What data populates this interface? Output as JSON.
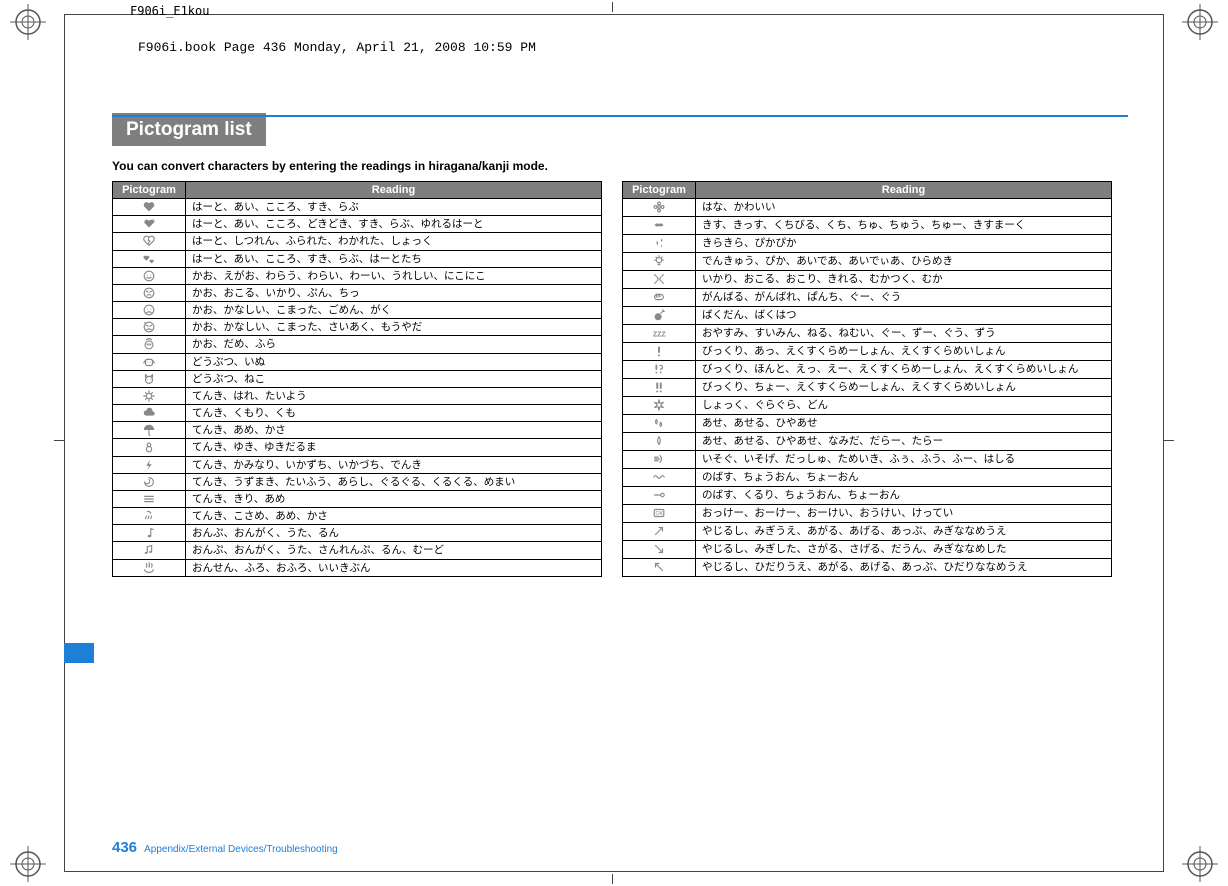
{
  "crop": {
    "filename": "F906i_E1kou",
    "header_note": "F906i.book  Page 436  Monday, April 21, 2008  10:59 PM"
  },
  "page": {
    "title": "Pictogram list",
    "intro": "You can convert characters by entering the readings in hiragana/kanji mode.",
    "footer_page": "436",
    "footer_section": "Appendix/External Devices/Troubleshooting"
  },
  "headers": {
    "picto": "Pictogram",
    "reading": "Reading"
  },
  "left": [
    {
      "p": "heart",
      "r": "はーと、あい、こころ、すき、らぶ"
    },
    {
      "p": "heart-beat",
      "r": "はーと、あい、こころ、どきどき、すき、らぶ、ゆれるはーと"
    },
    {
      "p": "heart-broken",
      "r": "はーと、しつれん、ふられた、わかれた、しょっく"
    },
    {
      "p": "hearts",
      "r": "はーと、あい、こころ、すき、らぶ、はーとたち"
    },
    {
      "p": "face-smile",
      "r": "かお、えがお、わらう、わらい、わーい、うれしい、にこにこ"
    },
    {
      "p": "face-angry",
      "r": "かお、おこる、いかり、ぷん、ちっ"
    },
    {
      "p": "face-sad",
      "r": "かお、かなしい、こまった、ごめん、がく"
    },
    {
      "p": "face-despair",
      "r": "かお、かなしい、こまった、さいあく、もうやだ"
    },
    {
      "p": "face-dizzy",
      "r": "かお、だめ、ふら"
    },
    {
      "p": "dog",
      "r": "どうぶつ、いぬ"
    },
    {
      "p": "cat",
      "r": "どうぶつ、ねこ"
    },
    {
      "p": "sun",
      "r": "てんき、はれ、たいよう"
    },
    {
      "p": "cloud",
      "r": "てんき、くもり、くも"
    },
    {
      "p": "umbrella",
      "r": "てんき、あめ、かさ"
    },
    {
      "p": "snowman",
      "r": "てんき、ゆき、ゆきだるま"
    },
    {
      "p": "lightning",
      "r": "てんき、かみなり、いかずち、いかづち、でんき"
    },
    {
      "p": "typhoon",
      "r": "てんき、うずまき、たいふう、あらし、ぐるぐる、くるくる、めまい"
    },
    {
      "p": "mist",
      "r": "てんき、きり、あめ"
    },
    {
      "p": "drizzle",
      "r": "てんき、こさめ、あめ、かさ"
    },
    {
      "p": "note",
      "r": "おんぷ、おんがく、うた、るん"
    },
    {
      "p": "notes",
      "r": "おんぷ、おんがく、うた、さんれんぷ、るん、むーど"
    },
    {
      "p": "hotspring",
      "r": "おんせん、ふろ、おふろ、いいきぶん"
    }
  ],
  "right": [
    {
      "p": "flower",
      "r": "はな、かわいい"
    },
    {
      "p": "kiss",
      "r": "きす、きっす、くちびる、くち、ちゅ、ちゅう、ちゅー、きすまーく"
    },
    {
      "p": "sparkle",
      "r": "きらきら、ぴかぴか"
    },
    {
      "p": "lightbulb",
      "r": "でんきゅう、ぴか、あいであ、あいでぃあ、ひらめき"
    },
    {
      "p": "anger",
      "r": "いかり、おこる、おこり、きれる、むかつく、むか"
    },
    {
      "p": "punch",
      "r": "がんばる、がんばれ、ぱんち、ぐー、ぐう"
    },
    {
      "p": "bomb",
      "r": "ばくだん、ばくはつ"
    },
    {
      "p": "zzz",
      "r": "おやすみ、すいみん、ねる、ねむい、ぐー、ずー、ぐう、ずう"
    },
    {
      "p": "exclaim",
      "r": "びっくり、あっ、えくすくらめーしょん、えくすくらめいしょん"
    },
    {
      "p": "exclaim-q",
      "r": "びっくり、ほんと、えっ、えー、えくすくらめーしょん、えくすくらめいしょん"
    },
    {
      "p": "double-exclaim",
      "r": "びっくり、ちょー、えくすくらめーしょん、えくすくらめいしょん"
    },
    {
      "p": "impact",
      "r": "しょっく、ぐらぐら、どん"
    },
    {
      "p": "sweat-drops",
      "r": "あせ、あせる、ひやあせ"
    },
    {
      "p": "sweat",
      "r": "あせ、あせる、ひやあせ、なみだ、だらー、たらー"
    },
    {
      "p": "dash",
      "r": "いそぐ、いそげ、だっしゅ、ためいき、ふぅ、ふう、ふー、はしる"
    },
    {
      "p": "wave",
      "r": "のばす、ちょうおん、ちょーおん"
    },
    {
      "p": "curl",
      "r": "のばす、くるり、ちょうおん、ちょーおん"
    },
    {
      "p": "ok",
      "r": "おっけー、おーけー、おーけい、おうけい、けってい"
    },
    {
      "p": "arrow-ur",
      "r": "やじるし、みぎうえ、あがる、あげる、あっぷ、みぎななめうえ"
    },
    {
      "p": "arrow-dr",
      "r": "やじるし、みぎした、さがる、さげる、だうん、みぎななめした"
    },
    {
      "p": "arrow-ul",
      "r": "やじるし、ひだりうえ、あがる、あげる、あっぷ、ひだりななめうえ"
    }
  ]
}
